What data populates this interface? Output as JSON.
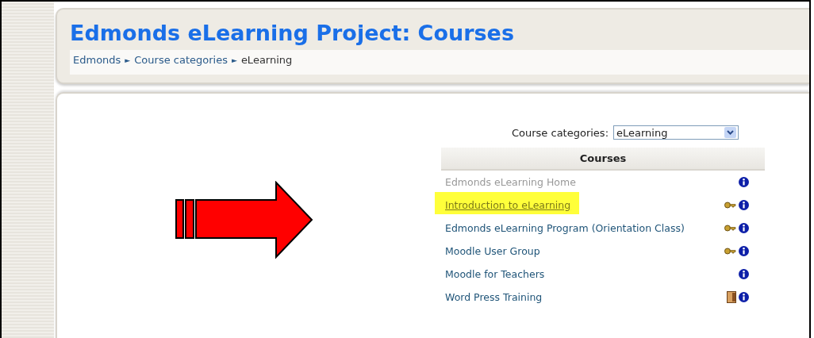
{
  "header": {
    "title": "Edmonds eLearning Project: Courses",
    "breadcrumb": [
      {
        "label": "Edmonds",
        "link": true
      },
      {
        "label": "Course categories",
        "link": true
      },
      {
        "label": "eLearning",
        "link": false
      }
    ],
    "separator": "►"
  },
  "category_select": {
    "label": "Course categories:",
    "value": "eLearning"
  },
  "courses": {
    "heading": "Courses",
    "rows": [
      {
        "name": "Edmonds eLearning Home",
        "hidden": true,
        "highlighted": false,
        "kind": "none"
      },
      {
        "name": "Introduction to eLearning",
        "hidden": false,
        "highlighted": true,
        "kind": "key"
      },
      {
        "name": "Edmonds eLearning Program (Orientation Class)",
        "hidden": false,
        "highlighted": false,
        "kind": "key"
      },
      {
        "name": "Moodle User Group",
        "hidden": false,
        "highlighted": false,
        "kind": "key"
      },
      {
        "name": "Moodle for Teachers",
        "hidden": false,
        "highlighted": false,
        "kind": "none"
      },
      {
        "name": "Word Press Training",
        "hidden": false,
        "highlighted": false,
        "kind": "door"
      }
    ]
  }
}
